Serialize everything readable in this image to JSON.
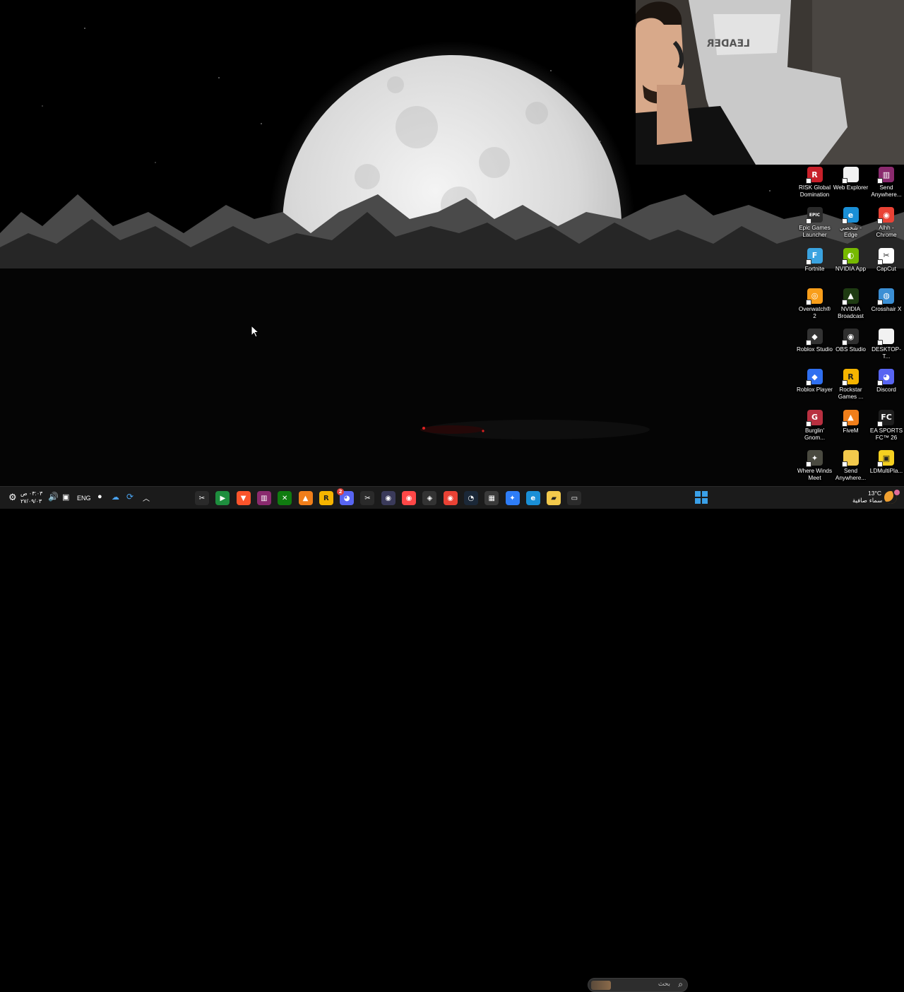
{
  "desktop_icons": [
    {
      "label": "RISK Global Domination",
      "icon": "risk-icon",
      "color": "#c8202a",
      "glyph": "R"
    },
    {
      "label": "Web Explorer",
      "icon": "file-icon",
      "color": "#f2f2f2",
      "glyph": ""
    },
    {
      "label": "Send Anywhere...",
      "icon": "winrar-icon",
      "color": "#8a2a6e",
      "glyph": "▥"
    },
    {
      "label": "Epic Games Launcher",
      "icon": "epic-games-icon",
      "color": "#2a2a2a",
      "glyph": "EPIC"
    },
    {
      "label": "شخصي - Edge",
      "icon": "edge-icon",
      "color": "#1a8fd6",
      "glyph": "e"
    },
    {
      "label": "Alhh - Chrome",
      "icon": "chrome-icon",
      "color": "#e94235",
      "glyph": "◉"
    },
    {
      "label": "Fortnite",
      "icon": "fortnite-icon",
      "color": "#3aa3e0",
      "glyph": "F"
    },
    {
      "label": "NVIDIA App",
      "icon": "nvidia-icon",
      "color": "#76b900",
      "glyph": "◐"
    },
    {
      "label": "CapCut",
      "icon": "capcut-icon",
      "color": "#ffffff",
      "glyph": "✂"
    },
    {
      "label": "Overwatch® 2",
      "icon": "overwatch-icon",
      "color": "#f99e1a",
      "glyph": "◎"
    },
    {
      "label": "NVIDIA Broadcast",
      "icon": "nvidia-broadcast-icon",
      "color": "#1e3b12",
      "glyph": "▲"
    },
    {
      "label": "Crosshair X",
      "icon": "crosshair-icon",
      "color": "#3b8fd4",
      "glyph": "◍"
    },
    {
      "label": "Roblox Studio",
      "icon": "roblox-studio-icon",
      "color": "#333333",
      "glyph": "◆"
    },
    {
      "label": "OBS Studio",
      "icon": "obs-icon",
      "color": "#2f2f2f",
      "glyph": "◉"
    },
    {
      "label": "DESKTOP-T...",
      "icon": "file-icon",
      "color": "#f2f2f2",
      "glyph": ""
    },
    {
      "label": "Roblox Player",
      "icon": "roblox-icon",
      "color": "#2f6ff0",
      "glyph": "◆"
    },
    {
      "label": "Rockstar Games ...",
      "icon": "rockstar-icon",
      "color": "#f5b400",
      "glyph": "R"
    },
    {
      "label": "Discord",
      "icon": "discord-icon",
      "color": "#5865f2",
      "glyph": "◕"
    },
    {
      "label": "Burglin' Gnom...",
      "icon": "burglin-gnomes-icon",
      "color": "#b83040",
      "glyph": "G"
    },
    {
      "label": "FiveM",
      "icon": "fivem-icon",
      "color": "#f07e1a",
      "glyph": "▲"
    },
    {
      "label": "EA SPORTS FC™ 26",
      "icon": "ea-sports-fc-icon",
      "color": "#1e1e1e",
      "glyph": "FC"
    },
    {
      "label": "Where Winds Meet",
      "icon": "where-winds-meet-icon",
      "color": "#4a4a40",
      "glyph": "✦"
    },
    {
      "label": "Send Anywhere...",
      "icon": "folder-icon",
      "color": "#f2c94c",
      "glyph": ""
    },
    {
      "label": "LDMultiPla...",
      "icon": "ldplayer-icon",
      "color": "#f5d020",
      "glyph": "▣"
    }
  ],
  "webcam": {
    "chair_brand": "LEADER"
  },
  "taskbar": {
    "start_icon": "windows-start-icon",
    "search_placeholder": "بحث",
    "apps": [
      {
        "icon": "task-view-icon",
        "color": "#2b2b2b",
        "glyph": "▭"
      },
      {
        "icon": "file-explorer-icon",
        "color": "#f2c94c",
        "glyph": "▰"
      },
      {
        "icon": "edge-icon",
        "color": "#1a8fd6",
        "glyph": "e"
      },
      {
        "icon": "copilot-icon",
        "color": "#2e7df7",
        "glyph": "✦"
      },
      {
        "icon": "store-icon",
        "color": "#3a3a3a",
        "glyph": "▦"
      },
      {
        "icon": "steam-icon",
        "color": "#1b2838",
        "glyph": "◔"
      },
      {
        "icon": "chrome-icon",
        "color": "#e94235",
        "glyph": "◉"
      },
      {
        "icon": "mouse-app-icon",
        "color": "#333333",
        "glyph": "◈"
      },
      {
        "icon": "ea-app-icon",
        "color": "#ff4747",
        "glyph": "◉"
      },
      {
        "icon": "obs-icon",
        "color": "#3a3a5a",
        "glyph": "◉"
      },
      {
        "icon": "capcut-icon",
        "color": "#2a2a2a",
        "glyph": "✂"
      },
      {
        "icon": "discord-icon",
        "color": "#5865f2",
        "glyph": "◕"
      },
      {
        "icon": "rockstar-icon",
        "color": "#f5b400",
        "glyph": "R"
      },
      {
        "icon": "fivem-icon",
        "color": "#f07e1a",
        "glyph": "▲"
      },
      {
        "icon": "xbox-icon",
        "color": "#107c10",
        "glyph": "✕"
      },
      {
        "icon": "winrar-icon",
        "color": "#8a2a6e",
        "glyph": "▥"
      },
      {
        "icon": "brave-icon",
        "color": "#fb542b",
        "glyph": "▼"
      },
      {
        "icon": "green-app-icon",
        "color": "#1e8e3e",
        "glyph": "▶"
      },
      {
        "icon": "capcut-icon",
        "color": "#2a2a2a",
        "glyph": "✂"
      }
    ],
    "discord_badge": "2",
    "weather_temp": "13°C",
    "weather_desc": "سماء صافية",
    "language": "ENG",
    "clock_time": "٠٣:٠٣ ص",
    "clock_date": "٢٧/٠٩/٠٣"
  },
  "colors": {
    "taskbar_bg": "#1b1b1b",
    "moon": "#e8e8e8",
    "accent": "#3aa0e8"
  }
}
